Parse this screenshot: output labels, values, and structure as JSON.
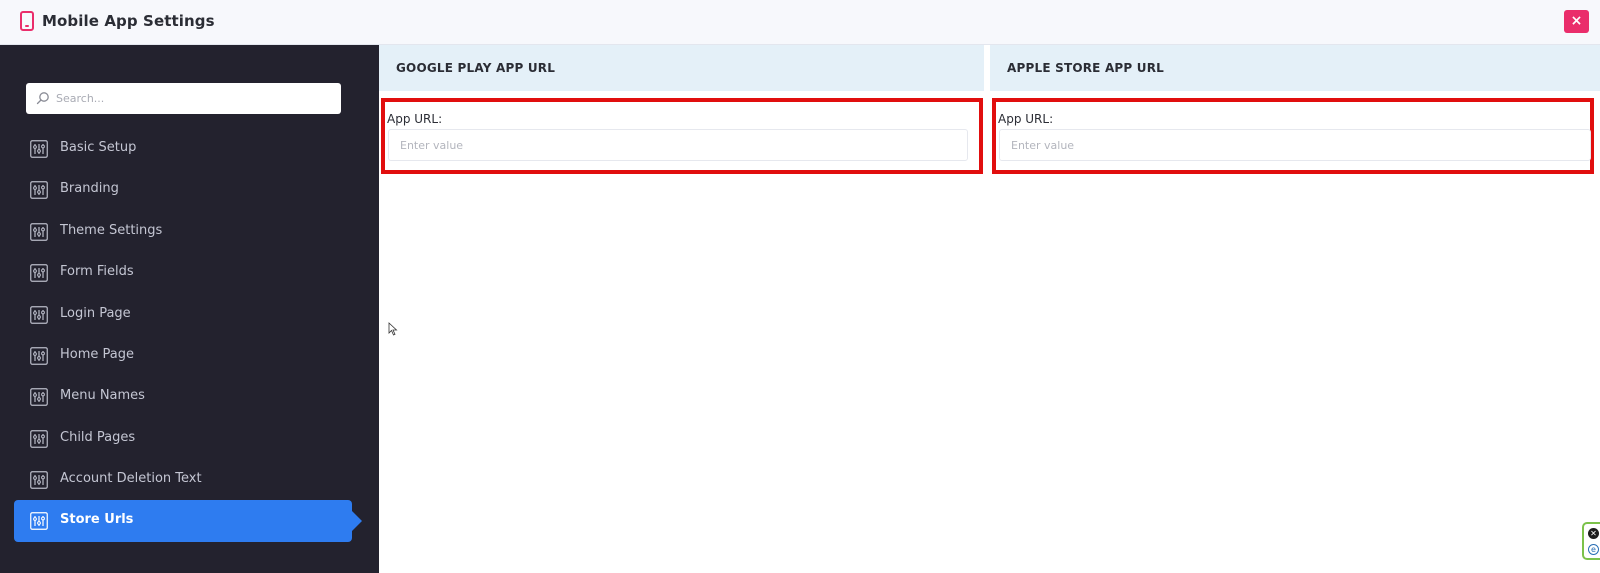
{
  "header": {
    "title": "Mobile App Settings",
    "close_label": "×",
    "app_icon": "mobile-phone-icon"
  },
  "sidebar": {
    "search": {
      "placeholder": "Search...",
      "value": ""
    },
    "items": [
      {
        "label": "Basic Setup",
        "icon": "sliders-icon",
        "active": false
      },
      {
        "label": "Branding",
        "icon": "sliders-icon",
        "active": false
      },
      {
        "label": "Theme Settings",
        "icon": "sliders-icon",
        "active": false
      },
      {
        "label": "Form Fields",
        "icon": "sliders-icon",
        "active": false
      },
      {
        "label": "Login Page",
        "icon": "sliders-icon",
        "active": false
      },
      {
        "label": "Home Page",
        "icon": "sliders-icon",
        "active": false
      },
      {
        "label": "Menu Names",
        "icon": "sliders-icon",
        "active": false
      },
      {
        "label": "Child Pages",
        "icon": "sliders-icon",
        "active": false
      },
      {
        "label": "Account Deletion Text",
        "icon": "sliders-icon",
        "active": false
      },
      {
        "label": "Store Urls",
        "icon": "sliders-icon",
        "active": true
      }
    ]
  },
  "main": {
    "google_play": {
      "heading": "GOOGLE PLAY APP URL",
      "field_label": "App URL:",
      "placeholder": "Enter value",
      "value": ""
    },
    "apple_store": {
      "heading": "APPLE STORE APP URL",
      "field_label": "App URL:",
      "placeholder": "Enter value",
      "value": ""
    }
  },
  "colors": {
    "accent_pink": "#ea2d6b",
    "sidebar_bg": "#23222e",
    "active_blue": "#2e7cf0",
    "highlight_red": "#e10e0e",
    "panel_header_bg": "#e4f0f8"
  }
}
